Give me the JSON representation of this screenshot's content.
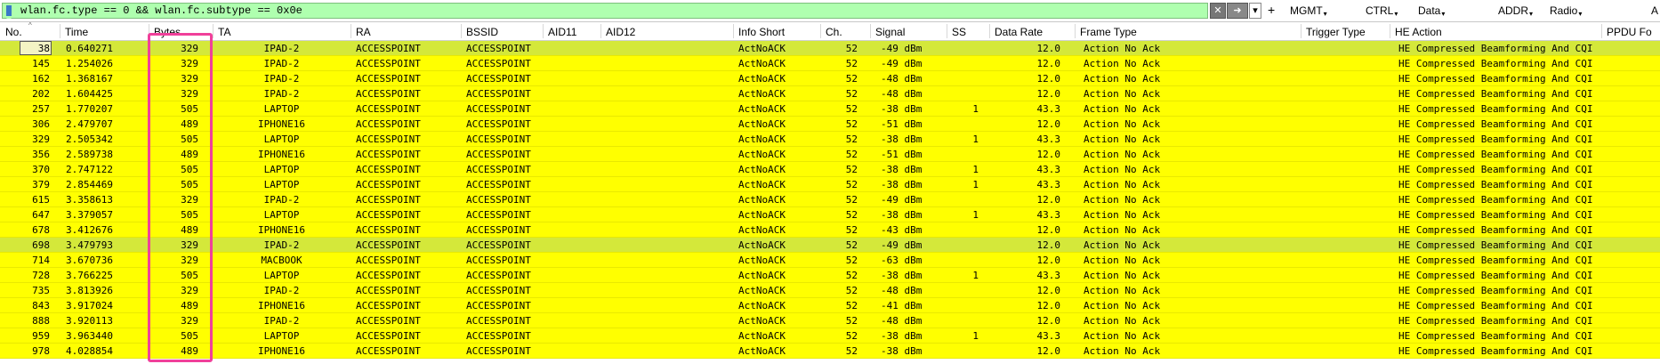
{
  "filter": {
    "text": "wlan.fc.type == 0 && wlan.fc.subtype == 0x0e",
    "plus": "+",
    "clear_icon": "x-icon",
    "apply_icon": "arrow-right-icon"
  },
  "quick_buttons": [
    "MGMT",
    "CTRL",
    "Data",
    "ADDR",
    "Radio",
    "A"
  ],
  "columns": [
    "No.",
    "Time",
    "Bytes",
    "TA",
    "RA",
    "BSSID",
    "AID11",
    "AID12",
    "Info Short",
    "Ch.",
    "Signal",
    "SS",
    "Data Rate",
    "Frame Type",
    "Trigger Type",
    "HE Action",
    "PPDU Fo"
  ],
  "rows": [
    {
      "no": "38",
      "time": "0.640271",
      "bytes": "329",
      "ta": "IPAD-2",
      "ra": "ACCESSPOINT",
      "bssid": "ACCESSPOINT",
      "info": "ActNoACK",
      "ch": "52",
      "signal": "-49 dBm",
      "ss": "",
      "rate": "12.0",
      "frame": "Action No Ack",
      "he": "HE Compressed Beamforming And CQI"
    },
    {
      "no": "145",
      "time": "1.254026",
      "bytes": "329",
      "ta": "IPAD-2",
      "ra": "ACCESSPOINT",
      "bssid": "ACCESSPOINT",
      "info": "ActNoACK",
      "ch": "52",
      "signal": "-49 dBm",
      "ss": "",
      "rate": "12.0",
      "frame": "Action No Ack",
      "he": "HE Compressed Beamforming And CQI"
    },
    {
      "no": "162",
      "time": "1.368167",
      "bytes": "329",
      "ta": "IPAD-2",
      "ra": "ACCESSPOINT",
      "bssid": "ACCESSPOINT",
      "info": "ActNoACK",
      "ch": "52",
      "signal": "-48 dBm",
      "ss": "",
      "rate": "12.0",
      "frame": "Action No Ack",
      "he": "HE Compressed Beamforming And CQI"
    },
    {
      "no": "202",
      "time": "1.604425",
      "bytes": "329",
      "ta": "IPAD-2",
      "ra": "ACCESSPOINT",
      "bssid": "ACCESSPOINT",
      "info": "ActNoACK",
      "ch": "52",
      "signal": "-48 dBm",
      "ss": "",
      "rate": "12.0",
      "frame": "Action No Ack",
      "he": "HE Compressed Beamforming And CQI"
    },
    {
      "no": "257",
      "time": "1.770207",
      "bytes": "505",
      "ta": "LAPTOP",
      "ra": "ACCESSPOINT",
      "bssid": "ACCESSPOINT",
      "info": "ActNoACK",
      "ch": "52",
      "signal": "-38 dBm",
      "ss": "1",
      "rate": "43.3",
      "frame": "Action No Ack",
      "he": "HE Compressed Beamforming And CQI"
    },
    {
      "no": "306",
      "time": "2.479707",
      "bytes": "489",
      "ta": "IPHONE16",
      "ra": "ACCESSPOINT",
      "bssid": "ACCESSPOINT",
      "info": "ActNoACK",
      "ch": "52",
      "signal": "-51 dBm",
      "ss": "",
      "rate": "12.0",
      "frame": "Action No Ack",
      "he": "HE Compressed Beamforming And CQI"
    },
    {
      "no": "329",
      "time": "2.505342",
      "bytes": "505",
      "ta": "LAPTOP",
      "ra": "ACCESSPOINT",
      "bssid": "ACCESSPOINT",
      "info": "ActNoACK",
      "ch": "52",
      "signal": "-38 dBm",
      "ss": "1",
      "rate": "43.3",
      "frame": "Action No Ack",
      "he": "HE Compressed Beamforming And CQI"
    },
    {
      "no": "356",
      "time": "2.589738",
      "bytes": "489",
      "ta": "IPHONE16",
      "ra": "ACCESSPOINT",
      "bssid": "ACCESSPOINT",
      "info": "ActNoACK",
      "ch": "52",
      "signal": "-51 dBm",
      "ss": "",
      "rate": "12.0",
      "frame": "Action No Ack",
      "he": "HE Compressed Beamforming And CQI"
    },
    {
      "no": "370",
      "time": "2.747122",
      "bytes": "505",
      "ta": "LAPTOP",
      "ra": "ACCESSPOINT",
      "bssid": "ACCESSPOINT",
      "info": "ActNoACK",
      "ch": "52",
      "signal": "-38 dBm",
      "ss": "1",
      "rate": "43.3",
      "frame": "Action No Ack",
      "he": "HE Compressed Beamforming And CQI"
    },
    {
      "no": "379",
      "time": "2.854469",
      "bytes": "505",
      "ta": "LAPTOP",
      "ra": "ACCESSPOINT",
      "bssid": "ACCESSPOINT",
      "info": "ActNoACK",
      "ch": "52",
      "signal": "-38 dBm",
      "ss": "1",
      "rate": "43.3",
      "frame": "Action No Ack",
      "he": "HE Compressed Beamforming And CQI"
    },
    {
      "no": "615",
      "time": "3.358613",
      "bytes": "329",
      "ta": "IPAD-2",
      "ra": "ACCESSPOINT",
      "bssid": "ACCESSPOINT",
      "info": "ActNoACK",
      "ch": "52",
      "signal": "-49 dBm",
      "ss": "",
      "rate": "12.0",
      "frame": "Action No Ack",
      "he": "HE Compressed Beamforming And CQI"
    },
    {
      "no": "647",
      "time": "3.379057",
      "bytes": "505",
      "ta": "LAPTOP",
      "ra": "ACCESSPOINT",
      "bssid": "ACCESSPOINT",
      "info": "ActNoACK",
      "ch": "52",
      "signal": "-38 dBm",
      "ss": "1",
      "rate": "43.3",
      "frame": "Action No Ack",
      "he": "HE Compressed Beamforming And CQI"
    },
    {
      "no": "678",
      "time": "3.412676",
      "bytes": "489",
      "ta": "IPHONE16",
      "ra": "ACCESSPOINT",
      "bssid": "ACCESSPOINT",
      "info": "ActNoACK",
      "ch": "52",
      "signal": "-43 dBm",
      "ss": "",
      "rate": "12.0",
      "frame": "Action No Ack",
      "he": "HE Compressed Beamforming And CQI"
    },
    {
      "no": "698",
      "time": "3.479793",
      "bytes": "329",
      "ta": "IPAD-2",
      "ra": "ACCESSPOINT",
      "bssid": "ACCESSPOINT",
      "info": "ActNoACK",
      "ch": "52",
      "signal": "-49 dBm",
      "ss": "",
      "rate": "12.0",
      "frame": "Action No Ack",
      "he": "HE Compressed Beamforming And CQI"
    },
    {
      "no": "714",
      "time": "3.670736",
      "bytes": "329",
      "ta": "MACBOOK",
      "ra": "ACCESSPOINT",
      "bssid": "ACCESSPOINT",
      "info": "ActNoACK",
      "ch": "52",
      "signal": "-63 dBm",
      "ss": "",
      "rate": "12.0",
      "frame": "Action No Ack",
      "he": "HE Compressed Beamforming And CQI"
    },
    {
      "no": "728",
      "time": "3.766225",
      "bytes": "505",
      "ta": "LAPTOP",
      "ra": "ACCESSPOINT",
      "bssid": "ACCESSPOINT",
      "info": "ActNoACK",
      "ch": "52",
      "signal": "-38 dBm",
      "ss": "1",
      "rate": "43.3",
      "frame": "Action No Ack",
      "he": "HE Compressed Beamforming And CQI"
    },
    {
      "no": "735",
      "time": "3.813926",
      "bytes": "329",
      "ta": "IPAD-2",
      "ra": "ACCESSPOINT",
      "bssid": "ACCESSPOINT",
      "info": "ActNoACK",
      "ch": "52",
      "signal": "-48 dBm",
      "ss": "",
      "rate": "12.0",
      "frame": "Action No Ack",
      "he": "HE Compressed Beamforming And CQI"
    },
    {
      "no": "843",
      "time": "3.917024",
      "bytes": "489",
      "ta": "IPHONE16",
      "ra": "ACCESSPOINT",
      "bssid": "ACCESSPOINT",
      "info": "ActNoACK",
      "ch": "52",
      "signal": "-41 dBm",
      "ss": "",
      "rate": "12.0",
      "frame": "Action No Ack",
      "he": "HE Compressed Beamforming And CQI"
    },
    {
      "no": "888",
      "time": "3.920113",
      "bytes": "329",
      "ta": "IPAD-2",
      "ra": "ACCESSPOINT",
      "bssid": "ACCESSPOINT",
      "info": "ActNoACK",
      "ch": "52",
      "signal": "-48 dBm",
      "ss": "",
      "rate": "12.0",
      "frame": "Action No Ack",
      "he": "HE Compressed Beamforming And CQI"
    },
    {
      "no": "959",
      "time": "3.963440",
      "bytes": "505",
      "ta": "LAPTOP",
      "ra": "ACCESSPOINT",
      "bssid": "ACCESSPOINT",
      "info": "ActNoACK",
      "ch": "52",
      "signal": "-38 dBm",
      "ss": "1",
      "rate": "43.3",
      "frame": "Action No Ack",
      "he": "HE Compressed Beamforming And CQI"
    },
    {
      "no": "978",
      "time": "4.028854",
      "bytes": "489",
      "ta": "IPHONE16",
      "ra": "ACCESSPOINT",
      "bssid": "ACCESSPOINT",
      "info": "ActNoACK",
      "ch": "52",
      "signal": "-38 dBm",
      "ss": "",
      "rate": "12.0",
      "frame": "Action No Ack",
      "he": "HE Compressed Beamforming And CQI"
    }
  ],
  "colors": {
    "row": "#ffff00",
    "selected_row": "#d4e83a",
    "filter_bg": "#afffaf",
    "highlight": "#f0409a"
  }
}
